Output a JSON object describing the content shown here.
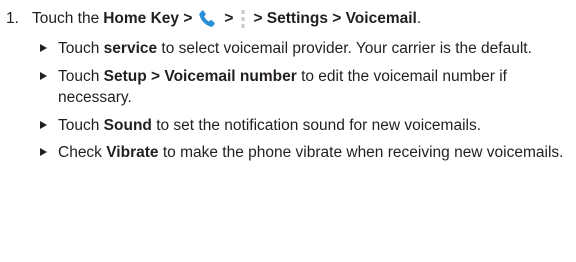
{
  "step": {
    "number": "1.",
    "prefix": "Touch the",
    "home_key": "Home Key >",
    "sep": ">",
    "path_rest": "> Settings > Voicemail",
    "period": ".",
    "icons": [
      "phone-icon",
      "menu-icon"
    ],
    "phone_icon_color": "#2a8fd6"
  },
  "bullets": [
    {
      "pre": "Touch ",
      "bold": "service",
      "post": " to select voicemail provider. Your carrier is the default."
    },
    {
      "pre": "Touch ",
      "bold": "Setup > Voicemail number",
      "post": " to edit the voicemail number if necessary."
    },
    {
      "pre": "Touch ",
      "bold": "Sound",
      "post": " to set the notification sound for new voicemails."
    },
    {
      "pre": "Check ",
      "bold": "Vibrate",
      "post": " to make the phone vibrate when receiving new voicemails."
    }
  ]
}
